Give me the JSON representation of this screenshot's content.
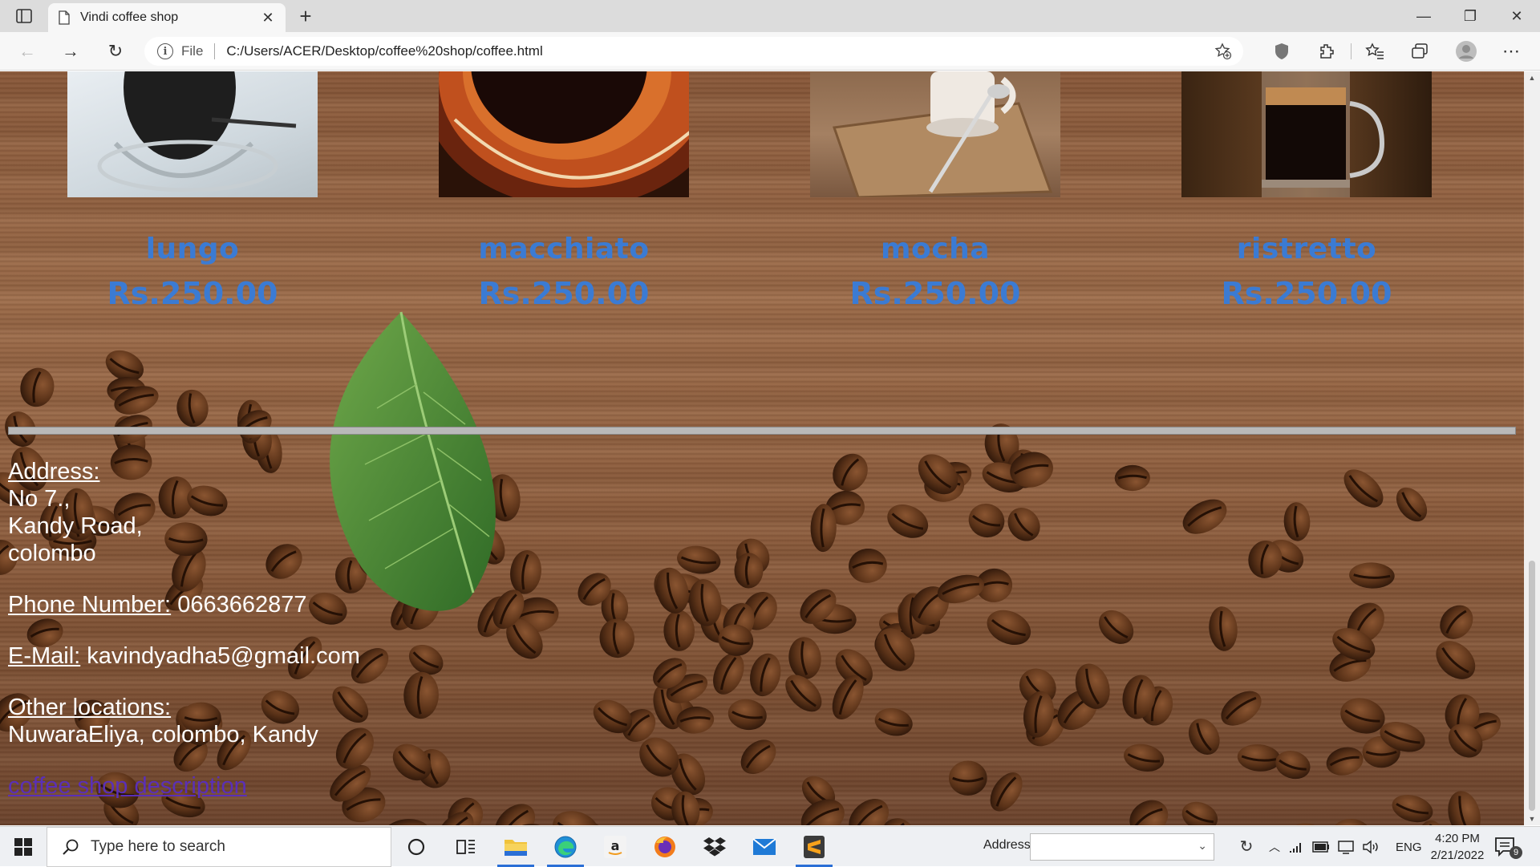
{
  "browser": {
    "tab_title": "Vindi coffee shop",
    "url_scheme": "File",
    "url": "C:/Users/ACER/Desktop/coffee%20shop/coffee.html"
  },
  "products": [
    {
      "name": "lungo",
      "price": "Rs.250.00",
      "photo": "lungo-photo"
    },
    {
      "name": "macchiato",
      "price": "Rs.250.00",
      "photo": "macchiato-photo"
    },
    {
      "name": "mocha",
      "price": "Rs.250.00",
      "photo": "mocha-photo"
    },
    {
      "name": "ristretto",
      "price": "Rs.250.00",
      "photo": "ristretto-photo"
    }
  ],
  "contact": {
    "address_label": "Address:",
    "address_lines": [
      "No 7.,",
      "Kandy Road,",
      "colombo"
    ],
    "phone_label": "Phone Number:",
    "phone": "0663662877",
    "email_label": "E-Mail:",
    "email": "kavindyadha5@gmail.com",
    "locations_label": "Other locations:",
    "locations": "NuwaraEliya, colombo, Kandy",
    "description_link": "coffee shop description"
  },
  "taskbar": {
    "search_placeholder": "Type here to search",
    "address_label": "Address",
    "language": "ENG",
    "time": "4:20 PM",
    "date": "2/21/2022",
    "notification_count": "9"
  },
  "colors": {
    "product_text": "#3b7bd3",
    "link": "#5a2fb8",
    "contact_text": "#ffffff",
    "taskbar_accent": "#2a6fd6"
  }
}
